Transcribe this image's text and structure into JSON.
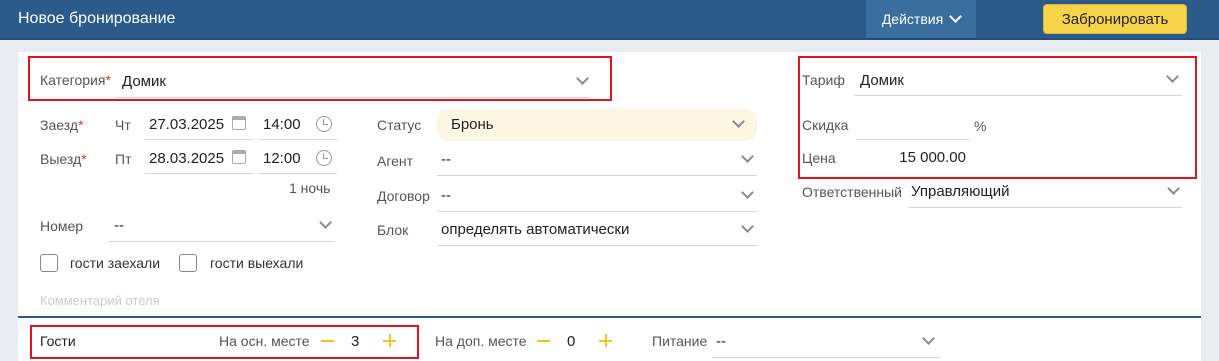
{
  "header": {
    "title": "Новое бронирование",
    "actions_label": "Действия",
    "book_label": "Забронировать"
  },
  "form": {
    "category": {
      "label": "Категория",
      "required": "*",
      "value": "Домик"
    },
    "checkin": {
      "label": "Заезд",
      "required": "*",
      "weekday": "Чт",
      "date": "27.03.2025",
      "time": "14:00"
    },
    "checkout": {
      "label": "Выезд",
      "required": "*",
      "weekday": "Пт",
      "date": "28.03.2025",
      "time": "12:00"
    },
    "nights": "1 ночь",
    "room": {
      "label": "Номер",
      "value": "--"
    },
    "guests_in_label": "гости заехали",
    "guests_out_label": "гости выехали",
    "comment_placeholder": "Комментарий отеля",
    "status": {
      "label": "Статус",
      "value": "Бронь"
    },
    "agent": {
      "label": "Агент",
      "value": "--"
    },
    "contract": {
      "label": "Договор",
      "value": "--"
    },
    "block": {
      "label": "Блок",
      "value": "определять автоматически"
    },
    "tariff": {
      "label": "Тариф",
      "value": "Домик"
    },
    "discount": {
      "label": "Скидка",
      "value": "",
      "unit": "%"
    },
    "price": {
      "label": "Цена",
      "value": "15 000.00"
    },
    "responsible": {
      "label": "Ответственный",
      "value": "Управляющий"
    }
  },
  "guests": {
    "label": "Гости",
    "main_place": {
      "label": "На осн. месте",
      "value": "3"
    },
    "extra_place": {
      "label": "На доп. месте",
      "value": "0"
    },
    "meals": {
      "label": "Питание",
      "value": "--"
    }
  },
  "colors": {
    "header_bg": "#2b5b8a",
    "accent_button": "#f5d44a",
    "highlight_border": "#e0141e"
  }
}
